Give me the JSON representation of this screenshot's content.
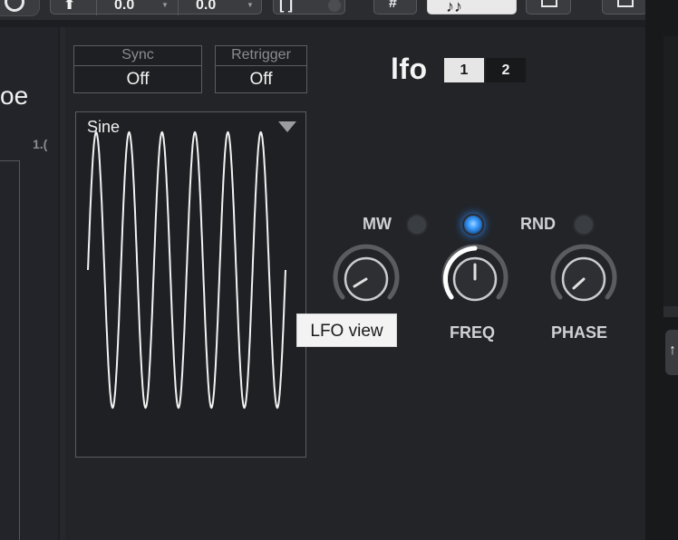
{
  "toolbar": {
    "value_1": "0.0",
    "value_2": "0.0",
    "icons": [
      "circle-icon",
      "arrow-up-icon",
      "bracket-icon",
      "hash-icon",
      "note-icon",
      "square-icon"
    ]
  },
  "left_panel": {
    "title_fragment": "oe",
    "number_fragment": "1.("
  },
  "sync": {
    "label": "Sync",
    "value": "Off"
  },
  "retrigger": {
    "label": "Retrigger",
    "value": "Off"
  },
  "waveform": {
    "selected": "Sine",
    "cycles": 6
  },
  "lfo": {
    "title": "lfo",
    "tabs": [
      {
        "label": "1",
        "active": true
      },
      {
        "label": "2",
        "active": false
      }
    ]
  },
  "knobs": {
    "mw": {
      "label": "MW",
      "led_on": false
    },
    "freq": {
      "label": "FREQ",
      "led_on": true
    },
    "rnd": {
      "label": "RND",
      "led_on": false
    },
    "phase": {
      "label": "PHASE"
    }
  },
  "tooltip": {
    "text": "LFO view"
  },
  "colors": {
    "background": "#1c1e21",
    "panel": "#222428",
    "accent_led": "#3b9cff",
    "waveform": "#f2f2f2",
    "tooltip_bg": "#f3f3f3"
  }
}
